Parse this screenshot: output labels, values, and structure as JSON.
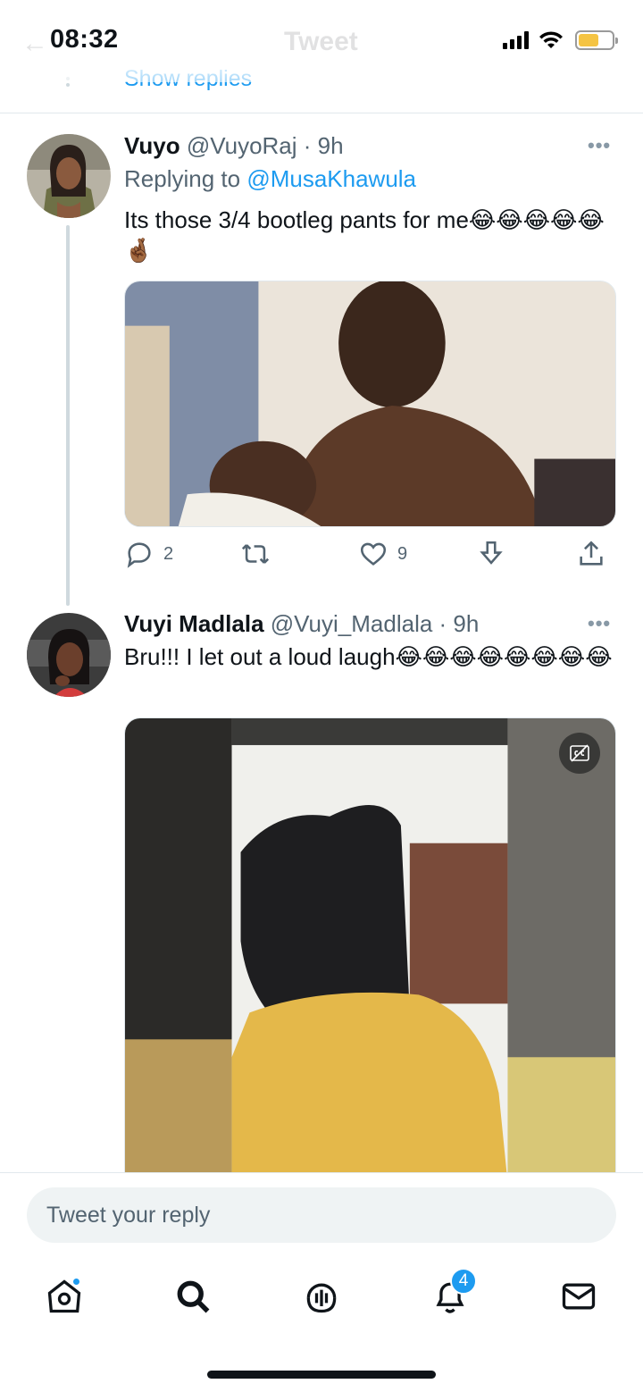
{
  "status_bar": {
    "time": "08:32",
    "battery_color": "#f5c443"
  },
  "header": {
    "title": "Tweet",
    "back_icon": "back-arrow-icon"
  },
  "thread": {
    "show_replies": "Show replies"
  },
  "tweets": [
    {
      "name": "Vuyo",
      "handle": "@VuyoRaj",
      "time": "· 9h",
      "replying_prefix": "Replying to",
      "replying_to": "@MusaKhawula",
      "text": "Its those 3/4 bootleg pants for me😂😂😂😂😂🤞🏾",
      "actions": {
        "replies": "2",
        "retweets": "",
        "likes": "9"
      }
    },
    {
      "name": "Vuyi Madlala",
      "handle": "@Vuyi_Madlala",
      "time": "· 9h",
      "text": "Bru!!! I let out a loud laugh😂😂😂😂😂😂😂😂"
    }
  ],
  "composer": {
    "placeholder": "Tweet your reply"
  },
  "tabbar": {
    "items": [
      "home-icon",
      "search-icon",
      "spaces-icon",
      "notifications-icon",
      "messages-icon"
    ],
    "notification_count": "4"
  },
  "colors": {
    "accent": "#1d9bf0",
    "secondary_text": "#536471",
    "divider": "#e1e8ed"
  }
}
